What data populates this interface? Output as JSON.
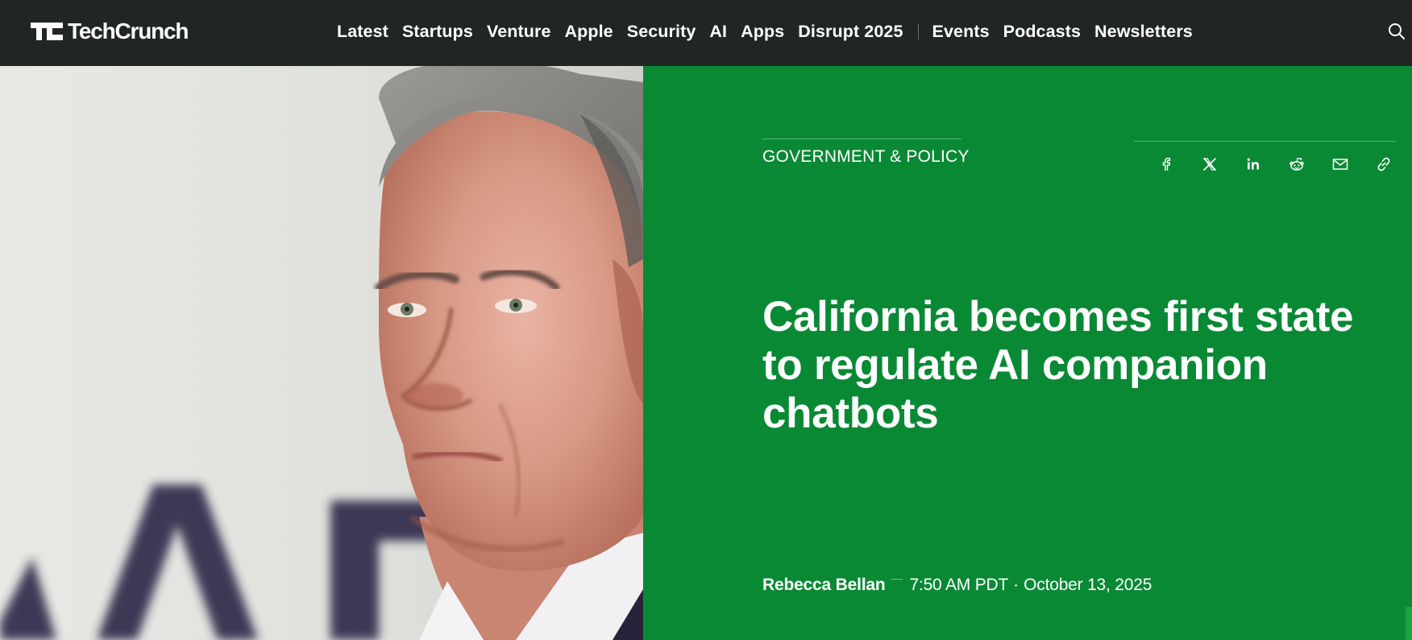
{
  "header": {
    "logo_text": "TechCrunch",
    "nav": [
      {
        "label": "Latest"
      },
      {
        "label": "Startups"
      },
      {
        "label": "Venture"
      },
      {
        "label": "Apple"
      },
      {
        "label": "Security"
      },
      {
        "label": "AI"
      },
      {
        "label": "Apps"
      },
      {
        "label": "Disrupt 2025"
      }
    ],
    "nav_secondary": [
      {
        "label": "Events"
      },
      {
        "label": "Podcasts"
      },
      {
        "label": "Newsletters"
      }
    ],
    "search_icon": "search-icon"
  },
  "article": {
    "category": "GOVERNMENT & POLICY",
    "headline": "California becomes first state to regulate AI companion chatbots",
    "author": "Rebecca Bellan",
    "time": "7:50 AM PDT",
    "separator": "·",
    "date": "October 13, 2025",
    "share_icons": [
      "facebook-icon",
      "x-icon",
      "linkedin-icon",
      "reddit-icon",
      "email-icon",
      "link-icon"
    ]
  },
  "colors": {
    "header_bg": "#212623",
    "panel_green": "#0a8935",
    "text": "#ffffff"
  }
}
